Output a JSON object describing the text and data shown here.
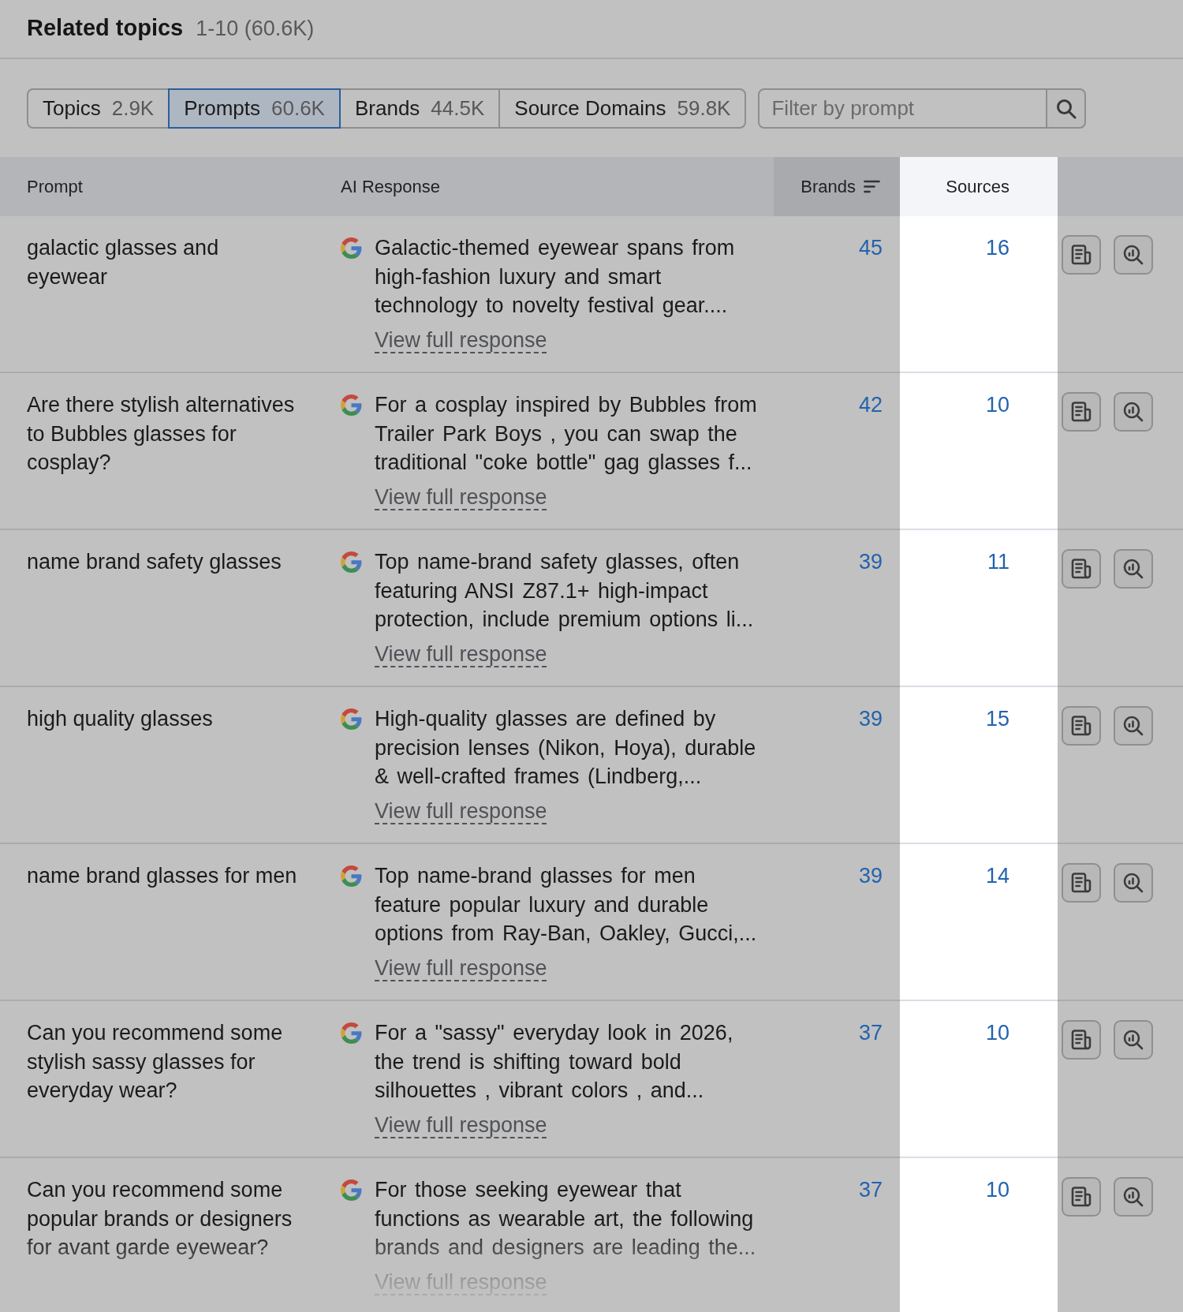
{
  "header": {
    "title": "Related topics",
    "range": "1-10 (60.6K)"
  },
  "tabs": [
    {
      "label": "Topics",
      "count": "2.9K",
      "selected": false
    },
    {
      "label": "Prompts",
      "count": "60.6K",
      "selected": true
    },
    {
      "label": "Brands",
      "count": "44.5K",
      "selected": false
    },
    {
      "label": "Source Domains",
      "count": "59.8K",
      "selected": false
    }
  ],
  "filter": {
    "placeholder": "Filter by prompt"
  },
  "table": {
    "columns": [
      {
        "label": "Prompt",
        "sorted": false,
        "highlighted": false
      },
      {
        "label": "AI Response",
        "sorted": false,
        "highlighted": false
      },
      {
        "label": "Brands",
        "sorted": true,
        "highlighted": false
      },
      {
        "label": "Sources",
        "sorted": false,
        "highlighted": true
      }
    ],
    "rows": [
      {
        "prompt": "galactic glasses and eyewear",
        "response": "Galactic-themed eyewear spans from high-fashion luxury and smart technology to novelty festival gear....",
        "link": "View full response",
        "brands": "45",
        "sources": "16"
      },
      {
        "prompt": "Are there stylish alternatives to Bubbles glasses for cosplay?",
        "response": "For a cosplay inspired by Bubbles from Trailer Park Boys , you can swap the traditional \"coke bottle\" gag glasses f...",
        "link": "View full response",
        "brands": "42",
        "sources": "10"
      },
      {
        "prompt": "name brand safety glasses",
        "response": "Top name-brand safety glasses, often featuring ANSI Z87.1+ high-impact protection, include premium options li...",
        "link": "View full response",
        "brands": "39",
        "sources": "11"
      },
      {
        "prompt": "high quality glasses",
        "response": "High-quality glasses are defined by precision lenses (Nikon, Hoya), durable & well-crafted frames (Lindberg,...",
        "link": "View full response",
        "brands": "39",
        "sources": "15"
      },
      {
        "prompt": "name brand glasses for men",
        "response": "Top name-brand glasses for men feature popular luxury and durable options from Ray-Ban, Oakley, Gucci,...",
        "link": "View full response",
        "brands": "39",
        "sources": "14"
      },
      {
        "prompt": "Can you recommend some stylish sassy glasses for everyday wear?",
        "response": "For a \"sassy\" everyday look in 2026, the trend is shifting toward bold silhouettes , vibrant colors , and...",
        "link": "View full response",
        "brands": "37",
        "sources": "10"
      },
      {
        "prompt": "Can you recommend some popular brands or designers for avant garde eyewear?",
        "response": "For those seeking eyewear that functions as wearable art, the following brands and designers are leading the...",
        "link": "View full response",
        "brands": "37",
        "sources": "10"
      }
    ]
  }
}
